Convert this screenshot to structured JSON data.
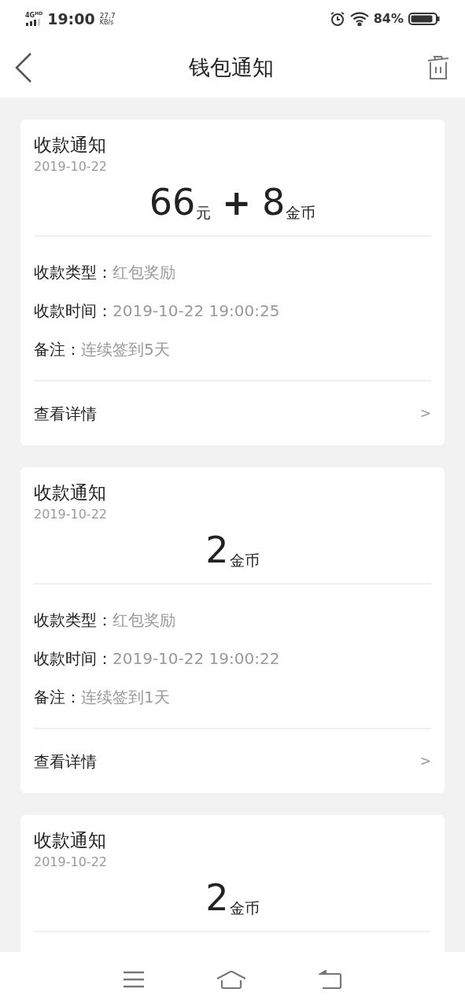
{
  "status_bar": {
    "network": "4G",
    "network_tag": "HD",
    "time": "19:00",
    "speed": "27.7",
    "speed_unit": "KB/s",
    "battery": "84%"
  },
  "header": {
    "title": "钱包通知"
  },
  "cards": [
    {
      "title": "收款通知",
      "date": "2019-10-22",
      "amounts": [
        {
          "number": "66",
          "unit": "元"
        },
        {
          "number": "8",
          "unit": "金币"
        }
      ],
      "separator": "+",
      "rows": [
        {
          "label": "收款类型：",
          "value": "红包奖励"
        },
        {
          "label": "收款时间：",
          "value": "2019-10-22 19:00:25"
        },
        {
          "label": "备注：",
          "value": "连续签到5天"
        }
      ],
      "footer": {
        "label": "查看详情",
        "chevron": ">"
      }
    },
    {
      "title": "收款通知",
      "date": "2019-10-22",
      "amounts": [
        {
          "number": "2",
          "unit": "金币"
        }
      ],
      "rows": [
        {
          "label": "收款类型：",
          "value": "红包奖励"
        },
        {
          "label": "收款时间：",
          "value": "2019-10-22 19:00:22"
        },
        {
          "label": "备注：",
          "value": "连续签到1天"
        }
      ],
      "footer": {
        "label": "查看详情",
        "chevron": ">"
      }
    },
    {
      "title": "收款通知",
      "date": "2019-10-22",
      "amounts": [
        {
          "number": "2",
          "unit": "金币"
        }
      ]
    }
  ]
}
